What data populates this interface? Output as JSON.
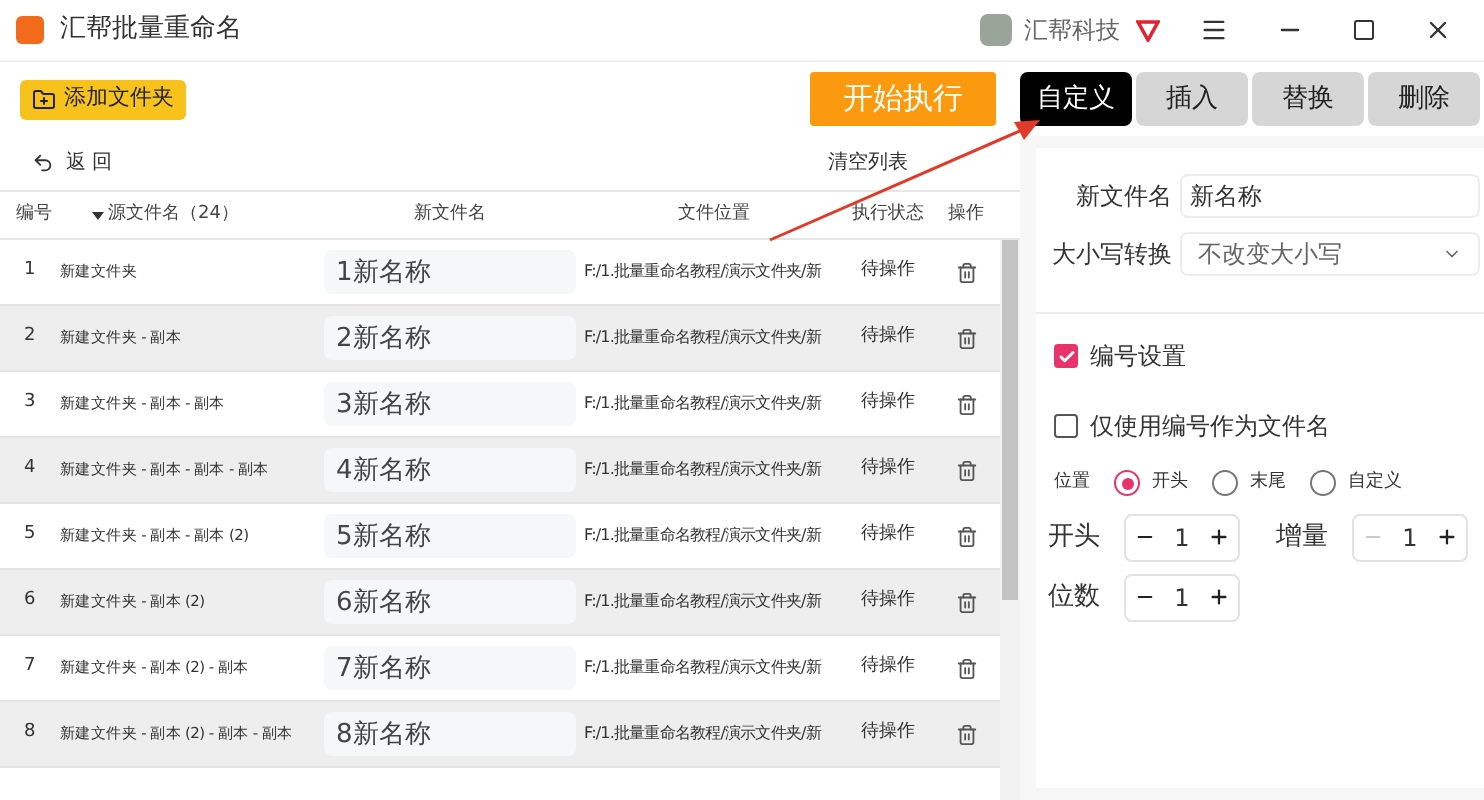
{
  "window": {
    "title": "汇帮批量重命名",
    "user": "汇帮科技"
  },
  "toolbar": {
    "add_folder": "添加文件夹",
    "start": "开始执行"
  },
  "tabs": [
    {
      "label": "自定义",
      "selected": true
    },
    {
      "label": "插入",
      "selected": false
    },
    {
      "label": "替换",
      "selected": false
    },
    {
      "label": "删除",
      "selected": false
    }
  ],
  "list_bar": {
    "back": "返 回",
    "clear": "清空列表"
  },
  "table": {
    "columns": [
      "编号",
      "源文件名（24）",
      "新文件名",
      "文件位置",
      "执行状态",
      "操作"
    ],
    "rows": [
      {
        "no": "1",
        "source": "新建文件夹",
        "new_name": "1新名称",
        "location": "F:/1.批量重命名教程/演示文件夹/新",
        "status": "待操作"
      },
      {
        "no": "2",
        "source": "新建文件夹 - 副本",
        "new_name": "2新名称",
        "location": "F:/1.批量重命名教程/演示文件夹/新",
        "status": "待操作"
      },
      {
        "no": "3",
        "source": "新建文件夹 - 副本 - 副本",
        "new_name": "3新名称",
        "location": "F:/1.批量重命名教程/演示文件夹/新",
        "status": "待操作"
      },
      {
        "no": "4",
        "source": "新建文件夹 - 副本 - 副本 - 副本",
        "new_name": "4新名称",
        "location": "F:/1.批量重命名教程/演示文件夹/新",
        "status": "待操作"
      },
      {
        "no": "5",
        "source": "新建文件夹 - 副本 - 副本 (2)",
        "new_name": "5新名称",
        "location": "F:/1.批量重命名教程/演示文件夹/新",
        "status": "待操作"
      },
      {
        "no": "6",
        "source": "新建文件夹 - 副本 (2)",
        "new_name": "6新名称",
        "location": "F:/1.批量重命名教程/演示文件夹/新",
        "status": "待操作"
      },
      {
        "no": "7",
        "source": "新建文件夹 - 副本 (2) - 副本",
        "new_name": "7新名称",
        "location": "F:/1.批量重命名教程/演示文件夹/新",
        "status": "待操作"
      },
      {
        "no": "8",
        "source": "新建文件夹 - 副本 (2) - 副本 - 副本",
        "new_name": "8新名称",
        "location": "F:/1.批量重命名教程/演示文件夹/新",
        "status": "待操作"
      }
    ]
  },
  "panel": {
    "new_name_label": "新文件名",
    "new_name_value": "新名称",
    "case_label": "大小写转换",
    "case_value": "不改变大小写",
    "checkboxes": [
      {
        "label": "编号设置",
        "checked": true
      },
      {
        "label": "仅使用编号作为文件名",
        "checked": false
      }
    ],
    "position_label": "位置",
    "positions": [
      {
        "label": "开头",
        "selected": true
      },
      {
        "label": "末尾",
        "selected": false
      },
      {
        "label": "自定义",
        "selected": false
      }
    ],
    "steppers": [
      {
        "label": "开头",
        "value": "1",
        "minus_disabled": false
      },
      {
        "label": "增量",
        "value": "1",
        "minus_disabled": true
      },
      {
        "label": "位数",
        "value": "1",
        "minus_disabled": false
      }
    ]
  }
}
